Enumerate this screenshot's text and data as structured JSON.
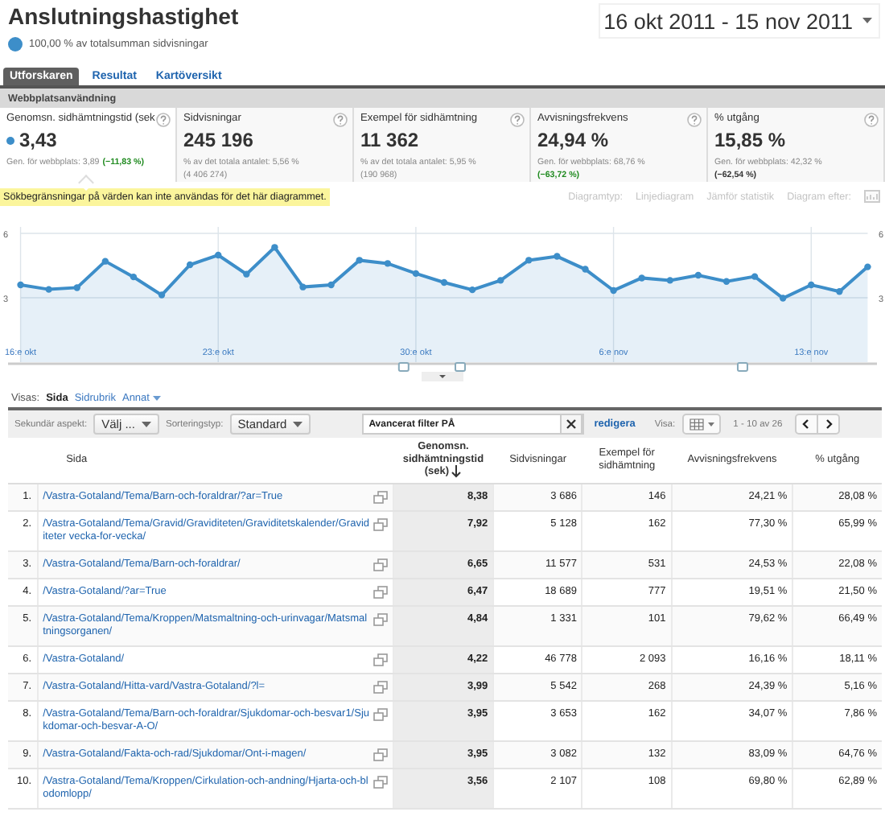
{
  "report": {
    "title": "Anslutningshastighet",
    "segment": "100,00 % av totalsumman sidvisningar",
    "date_range": "16 okt 2011 - 15 nov 2011"
  },
  "tabs": [
    {
      "label": "Utforskaren",
      "selected": true
    },
    {
      "label": "Resultat",
      "selected": false
    },
    {
      "label": "Kartöversikt",
      "selected": false
    }
  ],
  "section": "Webbplatsanvändning",
  "metrics": [
    {
      "label": "Genomsn. sidhämtningstid (sek",
      "value": "3,43",
      "note": "Gen. för webbplats: 3,89",
      "change": "(−11,83 %)",
      "kind": "positive",
      "inline": true,
      "selected": true
    },
    {
      "label": "Sidvisningar",
      "value": "245 196",
      "note": "% av det totala antalet: 5,56 %",
      "change": "(4 406 274)",
      "kind": "total",
      "inline": false,
      "selected": false
    },
    {
      "label": "Exempel för sidhämtning",
      "value": "11 362",
      "note": "% av det totala antalet: 5,95 %",
      "change": "(190 968)",
      "kind": "total",
      "inline": false,
      "selected": false
    },
    {
      "label": "Avvisningsfrekvens",
      "value": "24,94 %",
      "note": "Gen. för webbplats: 68,76 %",
      "change": "(−63,72 %)",
      "kind": "positive",
      "inline": false,
      "selected": false
    },
    {
      "label": "% utgång",
      "value": "15,85 %",
      "note": "Gen. för webbplats: 42,32 %",
      "change": "(−62,54 %)",
      "kind": "negative",
      "inline": false,
      "selected": false
    }
  ],
  "notice": "Sökbegränsningar på värden kan inte användas för det här diagrammet.",
  "chart_tools": [
    {
      "label": "Diagramtyp:",
      "disabled": true
    },
    {
      "label": "Linjediagram",
      "disabled": true
    },
    {
      "label": "Jämför statistik",
      "disabled": true
    },
    {
      "label": "Diagram efter:",
      "disabled": true
    }
  ],
  "chart": {
    "chart_data": {
      "type": "area",
      "ylim": [
        0,
        6
      ],
      "grid": true,
      "yticks": [
        3,
        6
      ],
      "y2lim": [
        0,
        6
      ],
      "y2ticks": [
        3,
        6
      ],
      "categories": [
        "16:e okt",
        null,
        null,
        null,
        null,
        null,
        null,
        "23:e okt",
        null,
        null,
        null,
        null,
        null,
        null,
        "30:e okt",
        null,
        null,
        null,
        null,
        null,
        null,
        "6:e nov",
        null,
        null,
        null,
        null,
        null,
        null,
        "13:e nov",
        null,
        null
      ],
      "series": [
        {
          "color": "#3d8ec9",
          "values": [
            3.6,
            3.39,
            3.47,
            4.7,
            3.97,
            3.13,
            4.54,
            4.99,
            4.1,
            5.35,
            3.5,
            3.6,
            4.75,
            4.6,
            4.13,
            3.71,
            3.37,
            3.81,
            4.75,
            4.93,
            4.33,
            3.34,
            3.92,
            3.81,
            4.05,
            3.76,
            3.99,
            2.98,
            3.6,
            3.29,
            4.44
          ]
        }
      ]
    }
  },
  "views": {
    "label": "Visas:",
    "options": [
      {
        "label": "Sida",
        "selected": true
      },
      {
        "label": "Sidrubrik",
        "selected": false
      },
      {
        "label": "Annat",
        "selected": false
      }
    ]
  },
  "toolbar": {
    "secondary_label": "Sekundär aspekt:",
    "secondary_value": "Välj ...",
    "sort_label": "Sorteringstyp:",
    "sort_value": "Standard",
    "filter": "Avancerat filter PÅ",
    "edit": "redigera",
    "show_label": "Visa:",
    "pagination": "1 - 10 av 26"
  },
  "table": {
    "columns": [
      {
        "kind": "index"
      },
      {
        "label": "Sida",
        "sorted": false
      },
      {
        "label": "Genomsn. sidhämtningstid (sek)",
        "sorted": true
      },
      {
        "label": "Sidvisningar",
        "sorted": false
      },
      {
        "label": "Exempel för sidhämtning",
        "sorted": false
      },
      {
        "label": "Avvisningsfrekvens",
        "sorted": false
      },
      {
        "label": "% utgång",
        "sorted": false
      }
    ],
    "rows": [
      [
        "1.",
        "/Vastra-Gotaland/Tema/Barn-och-foraldrar/?ar=True",
        "8,38",
        "3 686",
        "146",
        "24,21 %",
        "28,08 %"
      ],
      [
        "2.",
        "/Vastra-Gotaland/Tema/Gravid/Graviditeten/Graviditetskalender/Graviditeter vecka-for-vecka/",
        "7,92",
        "5 128",
        "162",
        "77,30 %",
        "65,99 %"
      ],
      [
        "3.",
        "/Vastra-Gotaland/Tema/Barn-och-foraldrar/",
        "6,65",
        "11 577",
        "531",
        "24,53 %",
        "22,08 %"
      ],
      [
        "4.",
        "/Vastra-Gotaland/?ar=True",
        "6,47",
        "18 689",
        "777",
        "19,51 %",
        "21,50 %"
      ],
      [
        "5.",
        "/Vastra-Gotaland/Tema/Kroppen/Matsmaltning-och-urinvagar/Matsmaltningsorganen/",
        "4,84",
        "1 331",
        "101",
        "79,62 %",
        "66,49 %"
      ],
      [
        "6.",
        "/Vastra-Gotaland/",
        "4,22",
        "46 778",
        "2 093",
        "16,16 %",
        "18,11 %"
      ],
      [
        "7.",
        "/Vastra-Gotaland/Hitta-vard/Vastra-Gotaland/?l=",
        "3,99",
        "5 542",
        "268",
        "24,39 %",
        "5,16 %"
      ],
      [
        "8.",
        "/Vastra-Gotaland/Tema/Barn-och-foraldrar/Sjukdomar-och-besvar1/Sjukdomar-och-besvar-A-O/",
        "3,95",
        "3 653",
        "162",
        "34,07 %",
        "7,86 %"
      ],
      [
        "9.",
        "/Vastra-Gotaland/Fakta-och-rad/Sjukdomar/Ont-i-magen/",
        "3,95",
        "3 082",
        "132",
        "83,09 %",
        "64,76 %"
      ],
      [
        "10.",
        "/Vastra-Gotaland/Tema/Kroppen/Cirkulation-och-andning/Hjarta-och-blodomlopp/",
        "3,56",
        "2 107",
        "108",
        "69,80 %",
        "62,89 %"
      ]
    ]
  }
}
